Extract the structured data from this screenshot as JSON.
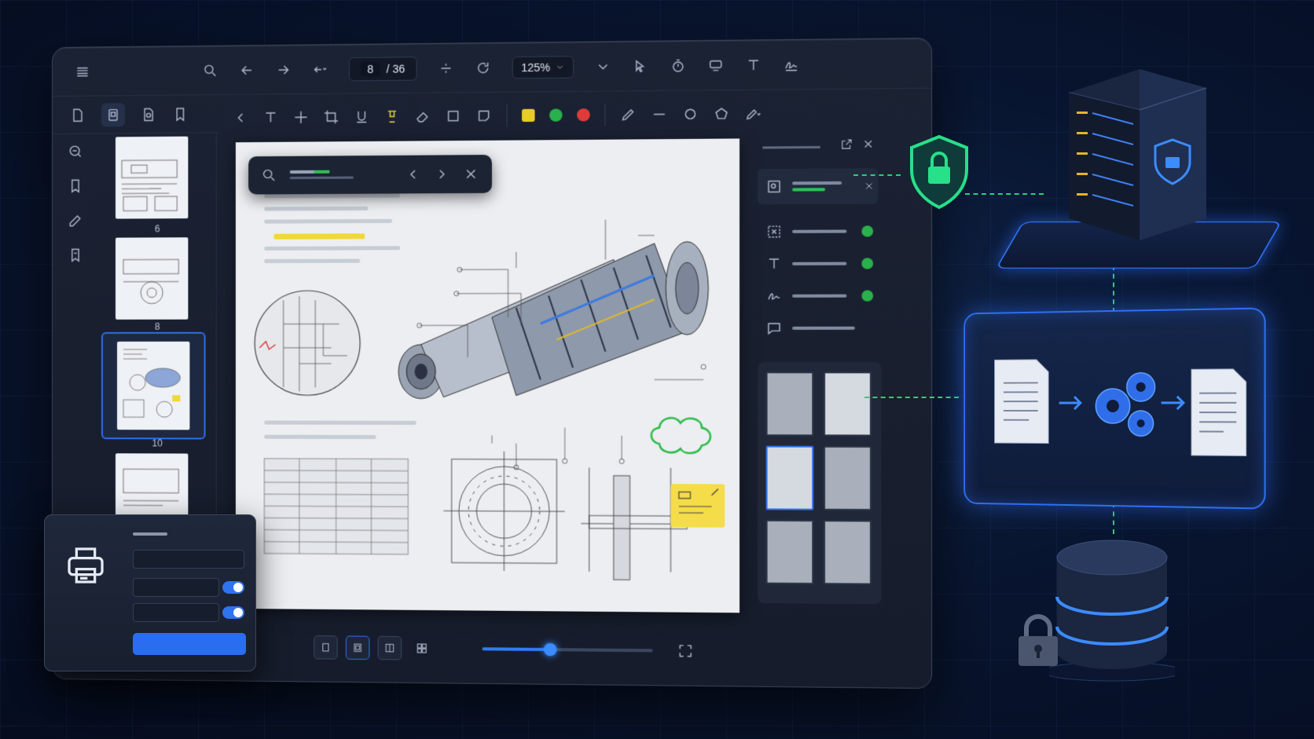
{
  "toolbar": {
    "page_current": "8",
    "page_total": "/ 36",
    "zoom": "125%"
  },
  "thumbnails": [
    {
      "label": "6"
    },
    {
      "label": "8"
    },
    {
      "label": "10"
    }
  ],
  "annotation_colors": [
    "#e9cc2a",
    "#29b14b",
    "#e23a3a"
  ],
  "icons": {
    "menu": "menu-icon",
    "search": "search-icon",
    "shield": "shield-lock-icon",
    "server": "server-icon",
    "database": "database-icon",
    "printer": "printer-icon"
  }
}
